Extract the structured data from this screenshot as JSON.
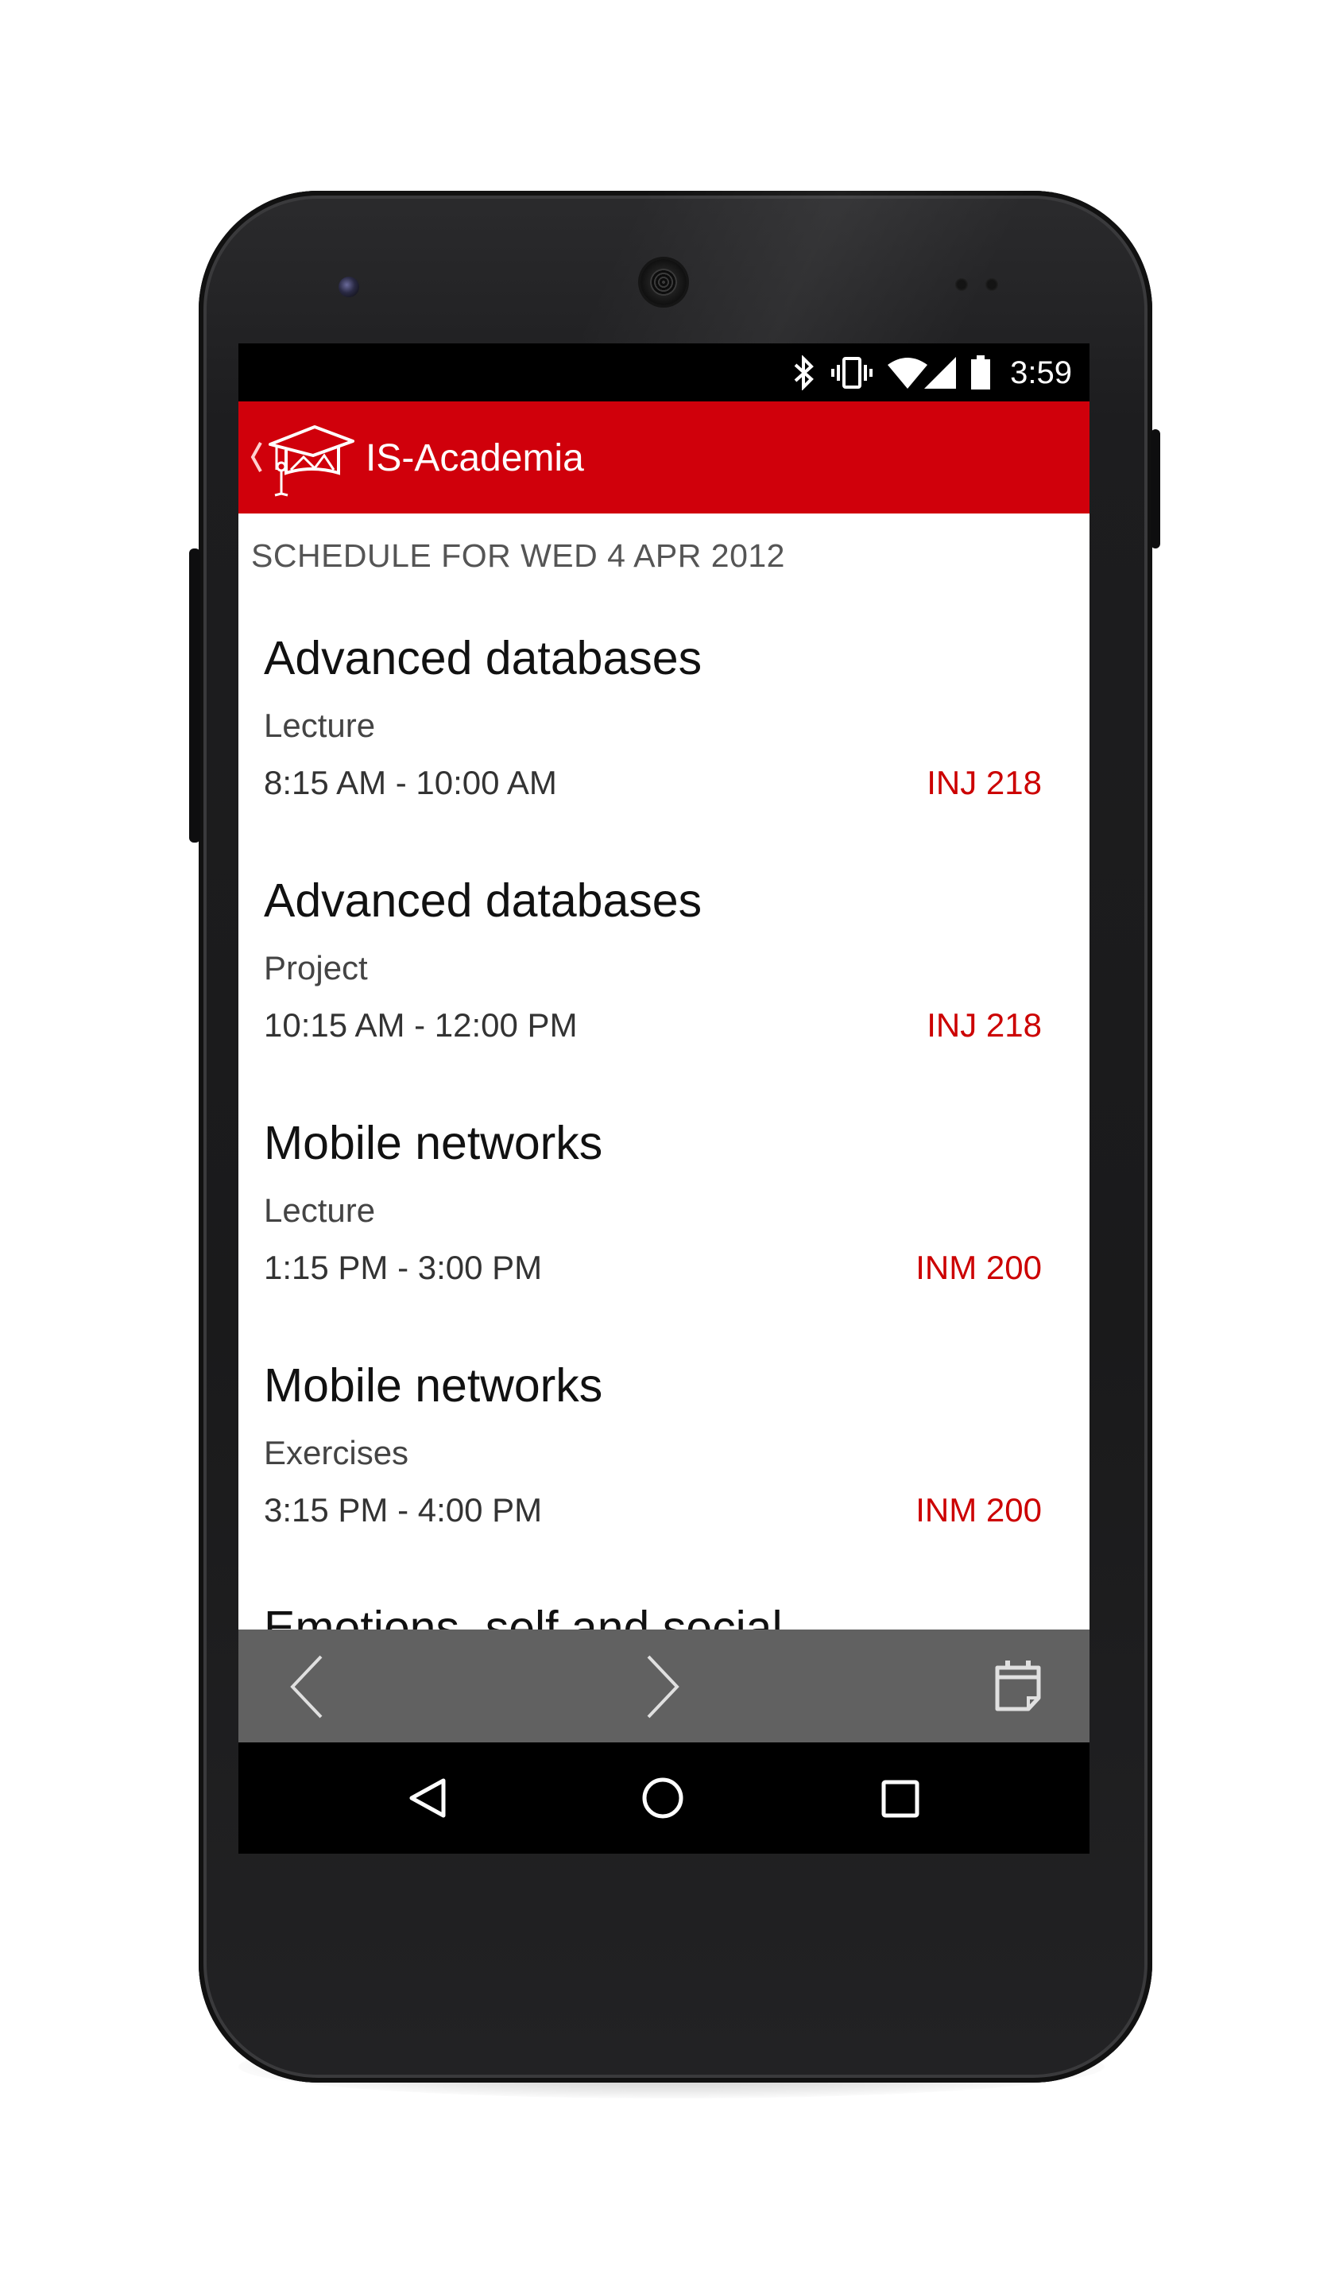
{
  "status_bar": {
    "time": "3:59",
    "icons": [
      "bluetooth-icon",
      "vibrate-icon",
      "wifi-icon",
      "signal-icon",
      "battery-icon"
    ]
  },
  "app_bar": {
    "title": "IS-Academia",
    "logo": "graduation-cap-icon",
    "color": "#d0000b"
  },
  "schedule": {
    "header": "SCHEDULE FOR WED 4 APR 2012",
    "entries": [
      {
        "title": "Advanced databases",
        "type": "Lecture",
        "time": "8:15 AM - 10:00 AM",
        "room": "INJ 218"
      },
      {
        "title": "Advanced databases",
        "type": "Project",
        "time": "10:15 AM - 12:00 PM",
        "room": "INJ 218"
      },
      {
        "title": "Mobile networks",
        "type": "Lecture",
        "time": "1:15 PM - 3:00 PM",
        "room": "INM 200"
      },
      {
        "title": "Mobile networks",
        "type": "Exercises",
        "time": "3:15 PM - 4:00 PM",
        "room": "INM 200"
      },
      {
        "title": "Emotions, self and social"
      }
    ],
    "room_color": "#cc0000"
  },
  "bottom_bar": {
    "icons": [
      "chevron-left-icon",
      "chevron-right-icon",
      "calendar-icon"
    ]
  },
  "nav_bar": {
    "icons": [
      "back-triangle-icon",
      "home-circle-icon",
      "recents-square-icon"
    ]
  }
}
